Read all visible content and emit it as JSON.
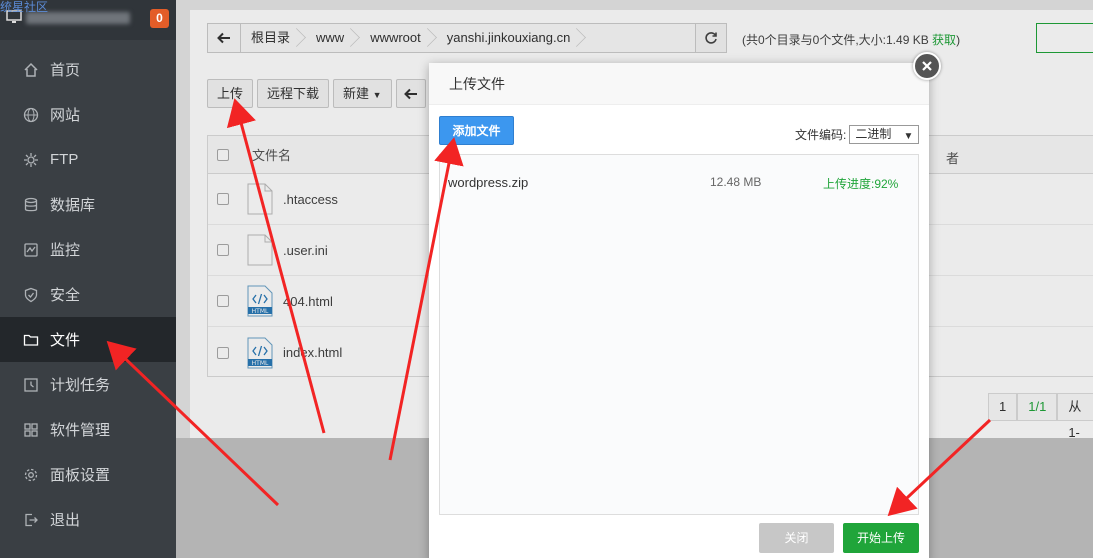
{
  "watermark": "统星社区",
  "sidebar": {
    "badge": "0",
    "items": [
      {
        "label": "首页",
        "icon": "home-icon"
      },
      {
        "label": "网站",
        "icon": "globe-icon"
      },
      {
        "label": "FTP",
        "icon": "ftp-icon"
      },
      {
        "label": "数据库",
        "icon": "database-icon"
      },
      {
        "label": "监控",
        "icon": "monitor-icon"
      },
      {
        "label": "安全",
        "icon": "shield-icon"
      },
      {
        "label": "文件",
        "icon": "folder-icon"
      },
      {
        "label": "计划任务",
        "icon": "clock-icon"
      },
      {
        "label": "软件管理",
        "icon": "apps-icon"
      },
      {
        "label": "面板设置",
        "icon": "gear-icon"
      },
      {
        "label": "退出",
        "icon": "logout-icon"
      }
    ]
  },
  "breadcrumb": [
    "根目录",
    "www",
    "wwwroot",
    "yanshi.jinkouxiang.cn"
  ],
  "dir_info": {
    "text": "(共0个目录与0个文件,大小:1.49 KB ",
    "get": "获取",
    "close": ")"
  },
  "toolbar": {
    "upload": "上传",
    "remote": "远程下载",
    "new": "新建"
  },
  "table": {
    "header_name": "文件名",
    "header_owner": "者",
    "rows": [
      {
        "name": ".htaccess",
        "type": "blank"
      },
      {
        "name": ".user.ini",
        "type": "blank"
      },
      {
        "name": "404.html",
        "type": "html"
      },
      {
        "name": "index.html",
        "type": "html"
      }
    ]
  },
  "pager": {
    "page": "1",
    "total": "1/1",
    "range": "从1-"
  },
  "modal": {
    "title": "上传文件",
    "add_file": "添加文件",
    "encoding_label": "文件编码:",
    "encoding_value": "二进制",
    "file": {
      "name": "wordpress.zip",
      "size": "12.48 MB",
      "progress": "上传进度:92%",
      "progress_value": 0.92
    },
    "close_btn": "关闭",
    "start_btn": "开始上传"
  },
  "colors": {
    "accent": "#20a53a",
    "blue": "#3c97ef",
    "badge": "#e35d28",
    "arrow": "#f22424"
  }
}
